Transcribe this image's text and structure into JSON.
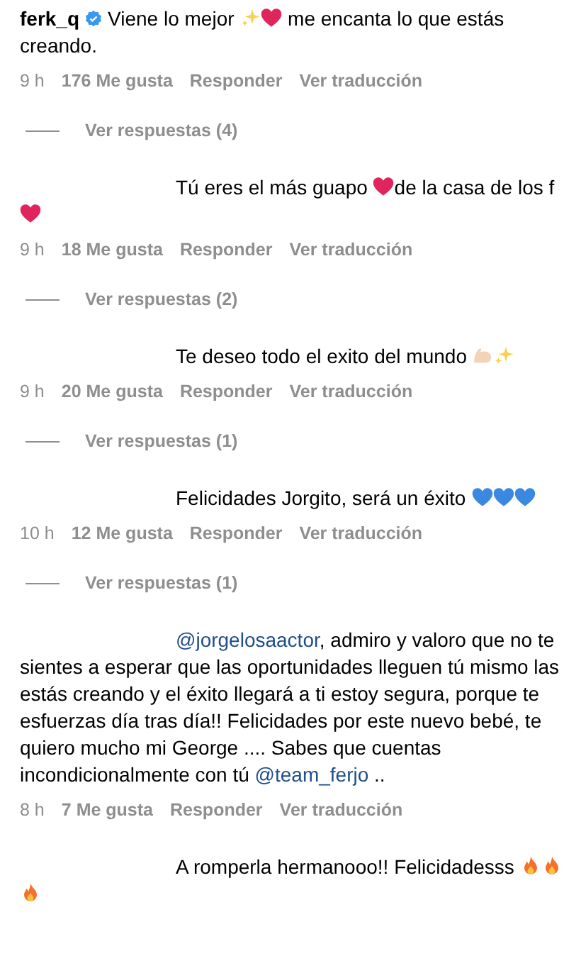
{
  "comments": [
    {
      "author": "ferk_q",
      "verified": true,
      "segments": [
        {
          "kind": "text",
          "text": "Viene lo mejor "
        },
        {
          "kind": "sparkles"
        },
        {
          "kind": "heart"
        },
        {
          "kind": "text",
          "text": " me encanta lo que estás creando."
        }
      ],
      "time": "9 h",
      "likes": "176 Me gusta",
      "reply": "Responder",
      "translate": "Ver traducción",
      "replies": "Ver respuestas (4)"
    },
    {
      "segments": [
        {
          "kind": "text",
          "text": "Tú eres el más guapo "
        },
        {
          "kind": "heart"
        },
        {
          "kind": "text",
          "text": "de la casa de los f"
        },
        {
          "kind": "heart"
        }
      ],
      "time": "9 h",
      "likes": "18 Me gusta",
      "reply": "Responder",
      "translate": "Ver traducción",
      "replies": "Ver respuestas (2)"
    },
    {
      "segments": [
        {
          "kind": "text",
          "text": "Te deseo todo el exito del mundo "
        },
        {
          "kind": "muscle"
        },
        {
          "kind": "sparkles"
        }
      ],
      "time": "9 h",
      "likes": "20 Me gusta",
      "reply": "Responder",
      "translate": "Ver traducción",
      "replies": "Ver respuestas (1)"
    },
    {
      "segments": [
        {
          "kind": "text",
          "text": "Felicidades Jorgito, será un éxito "
        },
        {
          "kind": "blue-heart"
        },
        {
          "kind": "blue-heart"
        },
        {
          "kind": "blue-heart"
        }
      ],
      "time": "10 h",
      "likes": "12 Me gusta",
      "reply": "Responder",
      "translate": "Ver traducción",
      "replies": "Ver respuestas (1)"
    },
    {
      "segments": [
        {
          "kind": "mention",
          "text": "@jorgelosaactor"
        },
        {
          "kind": "text",
          "text": ", admiro y valoro que no te sientes a esperar que las oportunidades lleguen tú mismo las estás creando y el éxito llegará a ti estoy segura, porque te esfuerzas día tras día!! Felicidades por este nuevo bebé, te quiero mucho mi George .... Sabes que cuentas incondicionalmente con tú "
        },
        {
          "kind": "mention",
          "text": "@team_ferjo"
        },
        {
          "kind": "text",
          "text": " .."
        }
      ],
      "time": "8 h",
      "likes": "7 Me gusta",
      "reply": "Responder",
      "translate": "Ver traducción"
    },
    {
      "segments": [
        {
          "kind": "text",
          "text": "A romperla hermanooo!! Felicidadesss "
        },
        {
          "kind": "fire"
        },
        {
          "kind": "fire"
        },
        {
          "kind": "fire"
        }
      ]
    }
  ]
}
